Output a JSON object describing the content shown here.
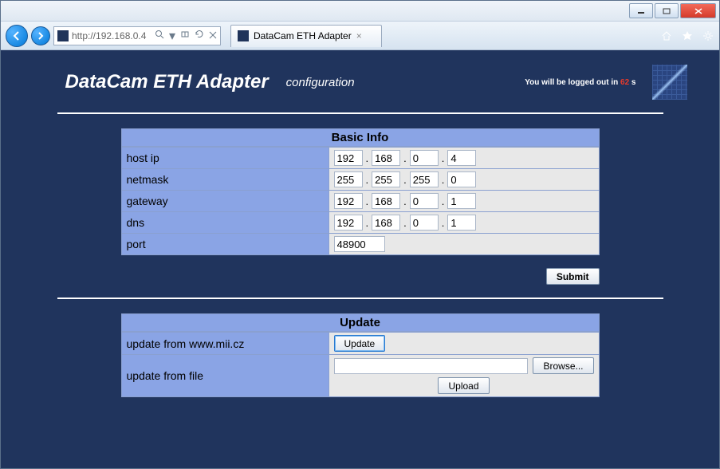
{
  "browser": {
    "url": "http://192.168.0.4",
    "tab_title": "DataCam ETH Adapter"
  },
  "header": {
    "title": "DataCam ETH Adapter",
    "subtitle": "configuration",
    "logout_prefix": "You will be logged out in ",
    "logout_seconds": "62",
    "logout_suffix": " s"
  },
  "basic_info": {
    "section_title": "Basic Info",
    "rows": {
      "host_ip": {
        "label": "host ip",
        "o1": "192",
        "o2": "168",
        "o3": "0",
        "o4": "4"
      },
      "netmask": {
        "label": "netmask",
        "o1": "255",
        "o2": "255",
        "o3": "255",
        "o4": "0"
      },
      "gateway": {
        "label": "gateway",
        "o1": "192",
        "o2": "168",
        "o3": "0",
        "o4": "1"
      },
      "dns": {
        "label": "dns",
        "o1": "192",
        "o2": "168",
        "o3": "0",
        "o4": "1"
      },
      "port": {
        "label": "port",
        "value": "48900"
      }
    },
    "submit_label": "Submit"
  },
  "update": {
    "section_title": "Update",
    "web_label": "update from www.mii.cz",
    "web_button": "Update",
    "file_label": "update from file",
    "browse_button": "Browse...",
    "upload_button": "Upload"
  }
}
